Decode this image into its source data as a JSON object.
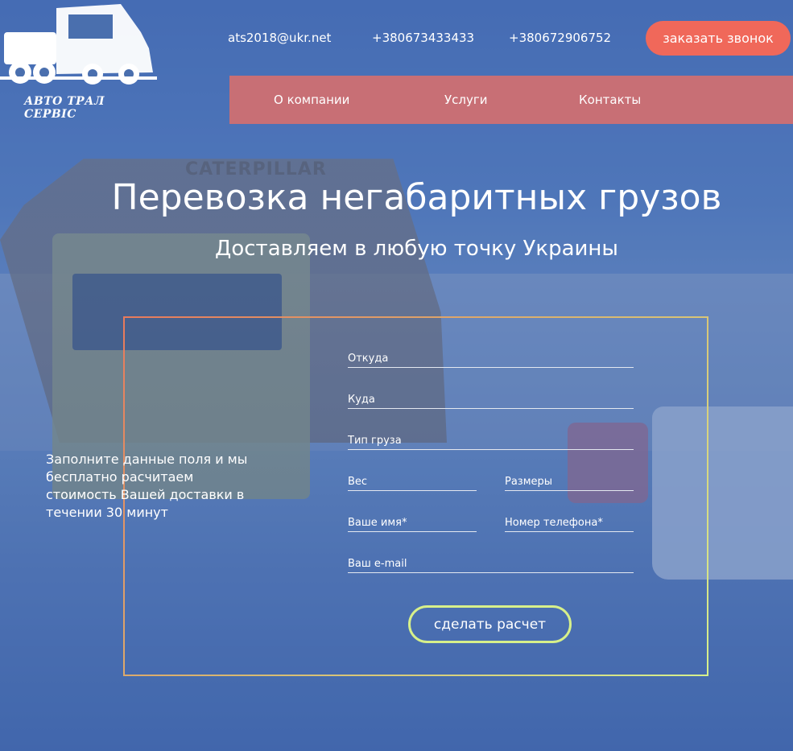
{
  "brand": {
    "logo_text": "АВТО ТРАЛ СЕРВІС"
  },
  "background": {
    "billboard_text": "CATERPILLAR"
  },
  "header": {
    "email": "ats2018@ukr.net",
    "phone1": "+380673433433",
    "phone2": "+380672906752",
    "callback_label": "заказать звонок",
    "accent_color": "#f0685a"
  },
  "nav": {
    "items": [
      {
        "label": "О компании"
      },
      {
        "label": "Услуги"
      },
      {
        "label": "Контакты"
      }
    ],
    "color": "#c86f75"
  },
  "hero": {
    "title": "Перевозка негабаритных грузов",
    "subtitle": "Доставляем в любую точку Украины"
  },
  "form": {
    "note": "Заполните данные поля и мы бесплатно расчитаем стоимость Вашей доставки в течении 30 минут",
    "fields": {
      "from": "Откуда",
      "to": "Куда",
      "cargo_type": "Тип груза",
      "weight": "Вес",
      "dimensions": "Размеры",
      "name": "Ваше имя*",
      "phone": "Номер телефона*",
      "email": "Ваш e-mail"
    },
    "submit_label": "сделать расчет",
    "submit_border_color": "#d7f08a"
  }
}
